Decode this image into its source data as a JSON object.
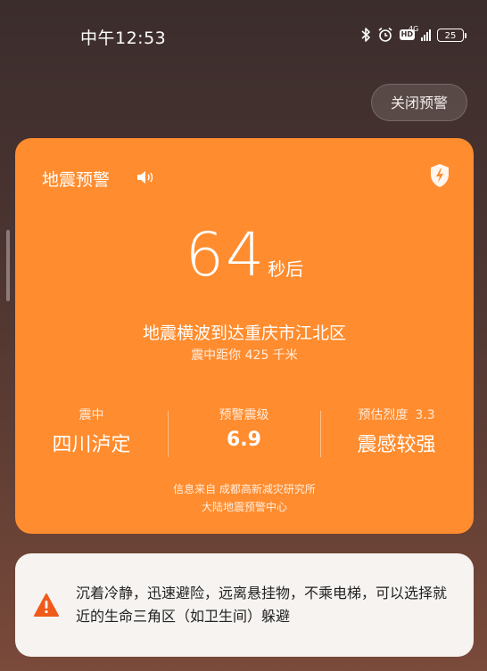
{
  "status_bar": {
    "time": "中午12:53",
    "network": "4G",
    "hd": "HD",
    "battery": "25"
  },
  "close_button": {
    "label": "关闭预警"
  },
  "alert": {
    "title": "地震预警",
    "countdown": "64",
    "countdown_unit": "秒后",
    "message": "地震横波到达重庆市江北区",
    "distance": "震中距你 425 千米",
    "epicenter_label": "震中",
    "epicenter_value": "四川泸定",
    "magnitude_label": "预警震级",
    "magnitude_value": "6.9",
    "intensity_label": "预估烈度",
    "intensity_number": "3.3",
    "intensity_value": "震感较强",
    "source_line1": "信息来自 成都高新减灾研究所",
    "source_line2": "大陆地震预警中心",
    "color": "#ff8c2e"
  },
  "tip": {
    "text": "沉着冷静，迅速避险，远离悬挂物，不乘电梯，可以选择就近的生命三角区（如卫生间）躲避",
    "icon_color": "#f05a1a"
  }
}
